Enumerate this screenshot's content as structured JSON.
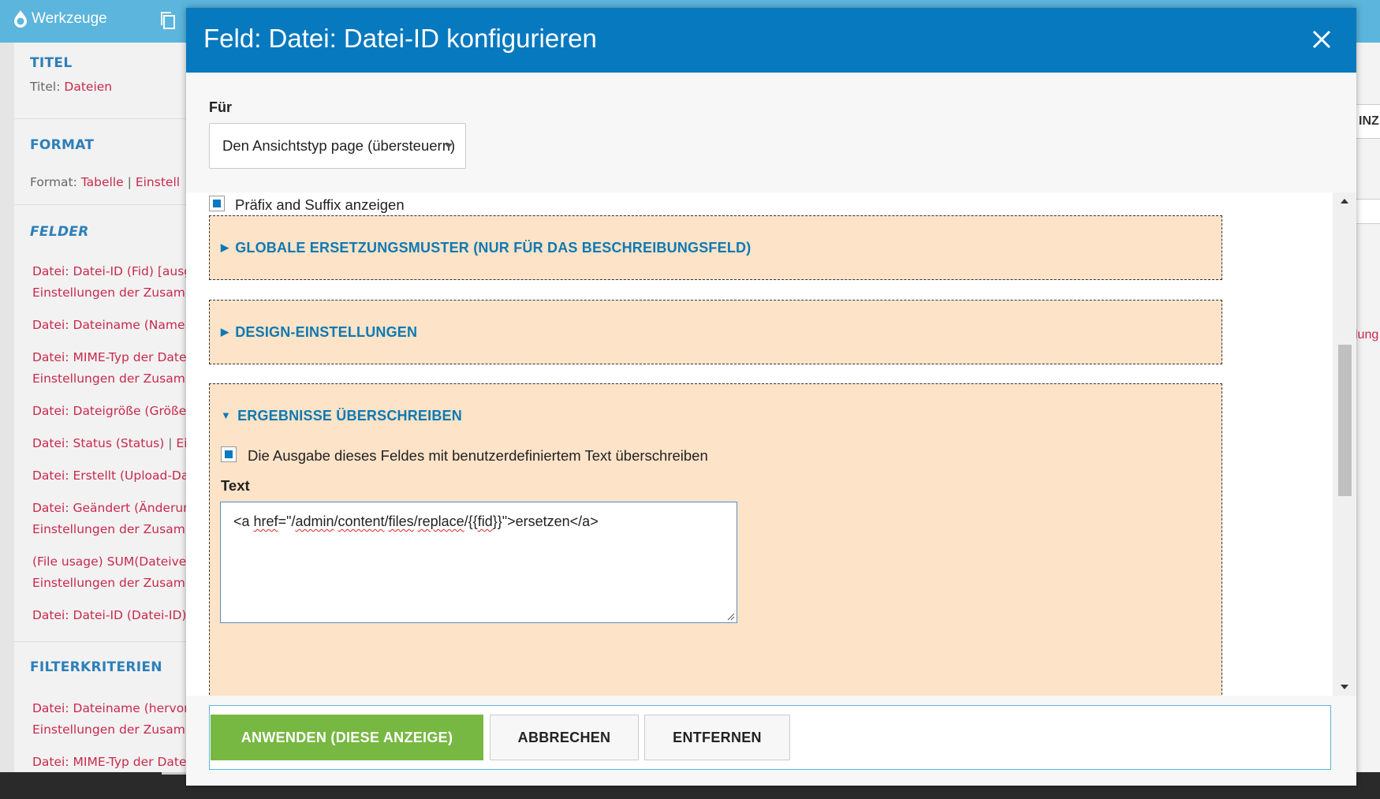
{
  "toolbar": {
    "brand": "Werkzeuge"
  },
  "sidebar": {
    "titel_heading": "TITEL",
    "titel_label": "Titel:",
    "titel_value": "Dateien",
    "format_heading": "FORMAT",
    "format_label": "Format:",
    "format_value": "Tabelle",
    "format_sep": "|",
    "format_settings": "Einstell",
    "felder_heading": "FELDER",
    "fields": [
      "Datei: Datei-ID (Fid) [ausge",
      "Einstellungen der Zusamm",
      "Datei: Dateiname (Name)",
      "Datei: MIME-Typ der Datei",
      "Einstellungen der Zusamm",
      "Datei: Dateigröße (Größe)",
      "Datei: Status (Status)",
      "Ei",
      "Datei: Erstellt (Upload-Dat",
      "Datei: Geändert (Änderun",
      "Einstellungen der Zusamm",
      "(File usage) SUM(Dateiver",
      "Einstellungen der Zusamm",
      "Datei: Datei-ID (Datei-ID)"
    ],
    "status_sep": "|",
    "fileid_sep": "|",
    "filter_heading": "FILTERKRITERIEN",
    "filters": [
      "Datei: Dateiname (hervorg",
      "Einstellungen der Zusamm",
      "Datei: MIME-Typ der Datei"
    ]
  },
  "right_strip": {
    "top_label": "INZ",
    "middle_link": "lung"
  },
  "modal": {
    "title": "Feld: Datei: Datei-ID konfigurieren",
    "close_icon": "close-icon",
    "fuer_label": "Für",
    "fuer_select_value": "Den Ansichtstyp page (übersteuern)",
    "prefix_suffix_label": "Präfix and Suffix anzeigen",
    "prefix_suffix_checked": true,
    "sections": [
      {
        "title": "GLOBALE ERSETZUNGSMUSTER (NUR FÜR DAS BESCHREIBUNGSFELD)",
        "expanded": false
      },
      {
        "title": "DESIGN-EINSTELLUNGEN",
        "expanded": false
      },
      {
        "title": "ERGEBNISSE ÜBERSCHREIBEN",
        "expanded": true
      }
    ],
    "override_checkbox_label": "Die Ausgabe dieses Feldes mit benutzerdefiniertem Text überschreiben",
    "override_checked": true,
    "text_label": "Text",
    "text_parts": [
      "<a ",
      "href",
      "=\"/",
      "admin",
      "/",
      "content",
      "/",
      "files",
      "/",
      "replace",
      "/{{",
      "fid",
      "}}\">ersetzen</a>"
    ],
    "buttons": {
      "apply": "ANWENDEN (DIESE ANZEIGE)",
      "cancel": "ABBRECHEN",
      "remove": "ENTFERNEN"
    }
  },
  "colors": {
    "header": "#0779bf",
    "toolbar": "#5bb5dc",
    "apply": "#77b842",
    "fieldset": "#fde3c8",
    "link": "#c8294c"
  }
}
